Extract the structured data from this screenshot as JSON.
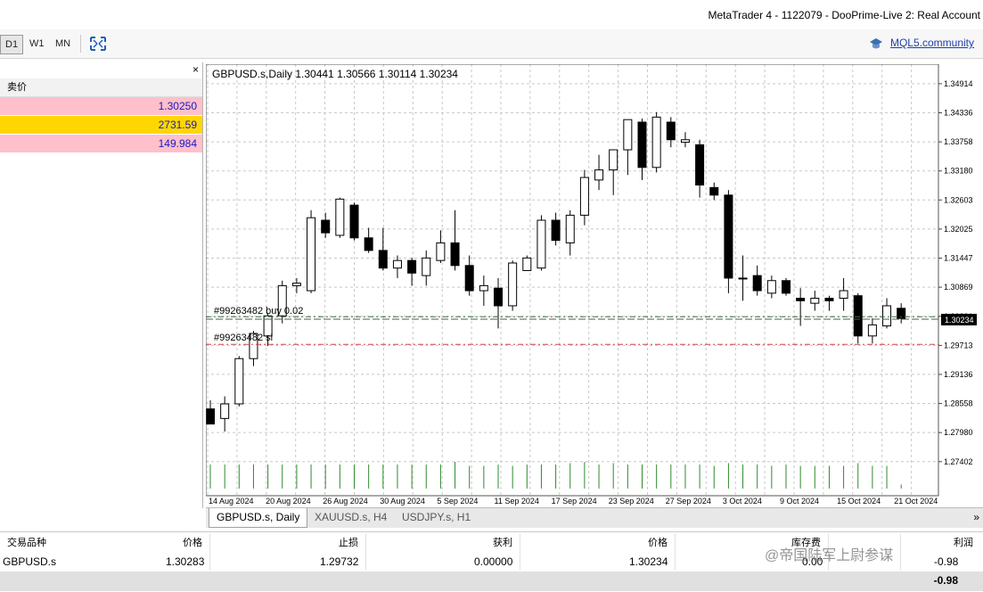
{
  "window": {
    "title": "MetaTrader 4 - 1122079 - DooPrime-Live 2: Real Account"
  },
  "toolbar": {
    "timeframes": [
      "D1",
      "W1",
      "MN"
    ],
    "active_timeframe": "D1",
    "fullscreen_icon": "expand-icon",
    "community_link": "MQL5.community",
    "community_icon": "graduation-cap-icon"
  },
  "market_watch": {
    "close_label": "×",
    "column_bid": "卖价",
    "rows": [
      {
        "bid": "1.30250",
        "bg": "#ffc0cb"
      },
      {
        "bid": "2731.59",
        "bg": "#ffd700"
      },
      {
        "bid": "149.984",
        "bg": "#ffc0cb"
      }
    ]
  },
  "chart": {
    "header": "GBPUSD.s,Daily  1.30441 1.30566 1.30114 1.30234",
    "order_labels": [
      "#99263482 buy 0.02",
      "#99263482 sl"
    ],
    "current_price_tag": "1.30234",
    "colors": {
      "bull": "#ffffff",
      "bear": "#000000",
      "grid": "#c8c8c8",
      "volume": "#2e8b2e",
      "sl_line": "#d04040",
      "entry_line": "#2e7d32"
    }
  },
  "chart_data": {
    "type": "candlestick",
    "symbol": "GBPUSD.s",
    "timeframe": "Daily",
    "ohlc_header": {
      "open": 1.30441,
      "high": 1.30566,
      "low": 1.30114,
      "close": 1.30234
    },
    "y_ticks": [
      "1.34914",
      "1.34336",
      "1.33758",
      "1.33180",
      "1.32603",
      "1.32025",
      "1.31447",
      "1.30869",
      "1.30291",
      "1.29713",
      "1.29136",
      "1.28558",
      "1.27980",
      "1.27402"
    ],
    "ylim": [
      1.2715,
      1.3516
    ],
    "x_ticks": [
      "14 Aug 2024",
      "20 Aug 2024",
      "26 Aug 2024",
      "30 Aug 2024",
      "5 Sep 2024",
      "11 Sep 2024",
      "17 Sep 2024",
      "23 Sep 2024",
      "27 Sep 2024",
      "3 Oct 2024",
      "9 Oct 2024",
      "15 Oct 2024",
      "21 Oct 2024"
    ],
    "entry_price": 1.30283,
    "stop_loss": 1.29732,
    "current_price": 1.30234,
    "candles": [
      [
        1.2845,
        1.2862,
        1.2815,
        1.2815
      ],
      [
        1.2826,
        1.287,
        1.28,
        1.2855
      ],
      [
        1.2855,
        1.295,
        1.285,
        1.2945
      ],
      [
        1.2945,
        1.3,
        1.293,
        1.2995
      ],
      [
        1.299,
        1.3035,
        1.297,
        1.303
      ],
      [
        1.303,
        1.31,
        1.3015,
        1.309
      ],
      [
        1.309,
        1.3105,
        1.3075,
        1.3095
      ],
      [
        1.308,
        1.324,
        1.3075,
        1.3225
      ],
      [
        1.322,
        1.3235,
        1.3185,
        1.3195
      ],
      [
        1.319,
        1.3265,
        1.3185,
        1.3262
      ],
      [
        1.325,
        1.3255,
        1.318,
        1.3185
      ],
      [
        1.3185,
        1.3205,
        1.3155,
        1.316
      ],
      [
        1.316,
        1.3205,
        1.312,
        1.3125
      ],
      [
        1.3125,
        1.315,
        1.3105,
        1.314
      ],
      [
        1.314,
        1.3145,
        1.309,
        1.3115
      ],
      [
        1.311,
        1.316,
        1.309,
        1.3145
      ],
      [
        1.314,
        1.32,
        1.3135,
        1.3175
      ],
      [
        1.3175,
        1.324,
        1.312,
        1.313
      ],
      [
        1.313,
        1.315,
        1.307,
        1.308
      ],
      [
        1.308,
        1.311,
        1.305,
        1.309
      ],
      [
        1.3085,
        1.3105,
        1.3005,
        1.305
      ],
      [
        1.305,
        1.314,
        1.304,
        1.3135
      ],
      [
        1.312,
        1.315,
        1.312,
        1.3145
      ],
      [
        1.3125,
        1.323,
        1.312,
        1.322
      ],
      [
        1.322,
        1.3235,
        1.317,
        1.318
      ],
      [
        1.3175,
        1.324,
        1.315,
        1.323
      ],
      [
        1.323,
        1.332,
        1.321,
        1.3305
      ],
      [
        1.33,
        1.335,
        1.328,
        1.332
      ],
      [
        1.332,
        1.336,
        1.327,
        1.336
      ],
      [
        1.336,
        1.342,
        1.331,
        1.342
      ],
      [
        1.3415,
        1.3422,
        1.33,
        1.3325
      ],
      [
        1.3325,
        1.3435,
        1.3315,
        1.3425
      ],
      [
        1.3415,
        1.3425,
        1.3365,
        1.338
      ],
      [
        1.3375,
        1.3395,
        1.3365,
        1.338
      ],
      [
        1.337,
        1.338,
        1.3265,
        1.329
      ],
      [
        1.3285,
        1.3295,
        1.326,
        1.327
      ],
      [
        1.327,
        1.328,
        1.3075,
        1.3105
      ],
      [
        1.3105,
        1.315,
        1.306,
        1.3105
      ],
      [
        1.311,
        1.313,
        1.307,
        1.308
      ],
      [
        1.3075,
        1.311,
        1.3065,
        1.31
      ],
      [
        1.31,
        1.3105,
        1.307,
        1.3075
      ],
      [
        1.3065,
        1.3085,
        1.301,
        1.306
      ],
      [
        1.3055,
        1.308,
        1.304,
        1.3065
      ],
      [
        1.3065,
        1.307,
        1.304,
        1.306
      ],
      [
        1.3065,
        1.3105,
        1.304,
        1.308
      ],
      [
        1.307,
        1.3075,
        1.2975,
        1.299
      ],
      [
        1.299,
        1.3025,
        1.2975,
        1.3012
      ],
      [
        1.301,
        1.3065,
        1.3005,
        1.305
      ],
      [
        1.3045,
        1.3055,
        1.3015,
        1.3025
      ]
    ],
    "volumes": [
      0.9,
      0.9,
      0.9,
      0.9,
      0.9,
      0.9,
      0.9,
      0.9,
      0.9,
      0.9,
      0.9,
      0.9,
      0.9,
      0.9,
      0.9,
      0.9,
      0.9,
      1.0,
      0.85,
      0.85,
      0.9,
      0.85,
      0.9,
      0.9,
      0.9,
      0.95,
      1.0,
      0.9,
      0.95,
      0.9,
      0.9,
      0.9,
      0.9,
      0.9,
      0.9,
      0.85,
      0.95,
      0.9,
      0.9,
      0.85,
      0.9,
      0.85,
      0.85,
      0.85,
      0.85,
      0.95,
      0.85,
      0.85,
      0.15
    ]
  },
  "chart_tabs": {
    "items": [
      "GBPUSD.s, Daily",
      "XAUUSD.s, H4",
      "USDJPY.s, H1"
    ],
    "active": "GBPUSD.s, Daily",
    "more_icon": "double-chevron-right-icon",
    "more_glyph": "»"
  },
  "terminal": {
    "headers": [
      "交易品种",
      "价格",
      "止损",
      "获利",
      "价格",
      "库存费",
      "利润"
    ],
    "row": [
      "GBPUSD.s",
      "1.30283",
      "1.29732",
      "0.00000",
      "1.30234",
      "0.00",
      "-0.98"
    ],
    "total": "-0.98"
  }
}
